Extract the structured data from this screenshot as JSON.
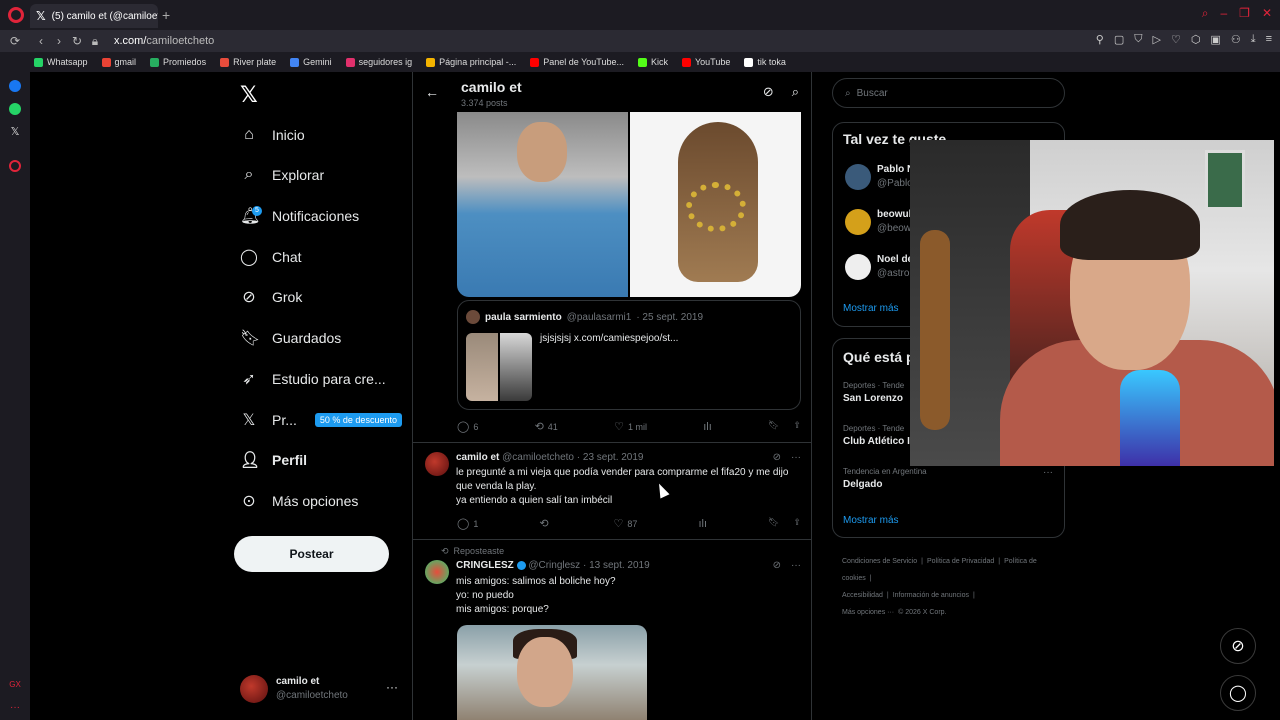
{
  "browser": {
    "tab_title": "(5) camilo et (@camiloetcheto",
    "url_host": "x.com/",
    "url_path": "camiloetcheto",
    "bookmarks": [
      {
        "label": "Whatsapp",
        "color": "#25d366"
      },
      {
        "label": "gmail",
        "color": "#ea4335"
      },
      {
        "label": "Promiedos",
        "color": "#27ae60"
      },
      {
        "label": "River plate",
        "color": "#e74c3c"
      },
      {
        "label": "Gemini",
        "color": "#4285f4"
      },
      {
        "label": "seguidores ig",
        "color": "#e1306c"
      },
      {
        "label": "Página principal -...",
        "color": "#f4b400"
      },
      {
        "label": "Panel de YouTube...",
        "color": "#ff0000"
      },
      {
        "label": "Kick",
        "color": "#53fc18"
      },
      {
        "label": "YouTube",
        "color": "#ff0000"
      },
      {
        "label": "tik toka",
        "color": "#ffffff"
      }
    ]
  },
  "nav": {
    "items": [
      {
        "label": "Inicio",
        "icon": "home-icon"
      },
      {
        "label": "Explorar",
        "icon": "search-icon"
      },
      {
        "label": "Notificaciones",
        "icon": "bell-icon",
        "badge": "5"
      },
      {
        "label": "Chat",
        "icon": "chat-icon"
      },
      {
        "label": "Grok",
        "icon": "grok-icon"
      },
      {
        "label": "Guardados",
        "icon": "bookmark-icon"
      },
      {
        "label": "Estudio para cre...",
        "icon": "rocket-icon"
      },
      {
        "label": "Pr...",
        "icon": "x-icon",
        "promo": "50 % de descuento"
      },
      {
        "label": "Perfil",
        "icon": "person-icon"
      },
      {
        "label": "Más opciones",
        "icon": "more-icon"
      }
    ],
    "post_button": "Postear",
    "me_name": "camilo et",
    "me_handle": "@camiloetcheto"
  },
  "profile_header": {
    "name": "camilo et",
    "posts": "3.374 posts"
  },
  "quote": {
    "name": "paula sarmiento",
    "handle": "@paulasarmi1",
    "date": "· 25 sept. 2019",
    "text": "jsjsjsjsj  x.com/camiespejoo/st..."
  },
  "tweet1_actions": {
    "replies": "6",
    "reposts": "41",
    "likes": "1 mil"
  },
  "tweet2": {
    "name": "camilo et",
    "handle": "@camiloetcheto",
    "date": "· 23 sept. 2019",
    "text": "le pregunté a mi vieja que podía vender para comprarme el fifa20 y me dijo que venda la play.\n ya entiendo a quien salí tan imbécil",
    "replies": "1",
    "reposts": "",
    "likes": "87"
  },
  "tweet3": {
    "repost_label": "Reposteaste",
    "name": "CRINGLESZ",
    "handle": "@Cringlesz",
    "date": "· 13 sept. 2019",
    "text": "mis amigos: salimos al boliche hoy?\nyo: no puedo\nmis amigos: porque?"
  },
  "right": {
    "search_placeholder": "Buscar",
    "suggest_title": "Tal vez te guste",
    "suggestions": [
      {
        "name": "Pablo N",
        "handle": "@Pablo"
      },
      {
        "name": "beowul",
        "handle": "@beow"
      },
      {
        "name": "Noel de",
        "handle": "@astron"
      }
    ],
    "show_more": "Mostrar más",
    "trends_title": "Qué está p",
    "trends": [
      {
        "context": "Deportes · Tende",
        "name": "San Lorenzo"
      },
      {
        "context": "Deportes · Tende",
        "name": "Club Atlético I"
      },
      {
        "context": "Tendencia en Argentina",
        "name": "Delgado"
      }
    ],
    "show_more2": "Mostrar más",
    "footer": [
      "Condiciones de Servicio",
      "|",
      "Política de Privacidad",
      "|",
      "Política de cookies",
      "|",
      "Accesibilidad",
      "|",
      "Información de anuncios",
      "|",
      "Más opciones ···",
      "© 2026 X Corp."
    ]
  },
  "colors": {
    "accent": "#1d9bf0",
    "bg": "#000000",
    "border": "#2f3336",
    "muted": "#71767b"
  }
}
